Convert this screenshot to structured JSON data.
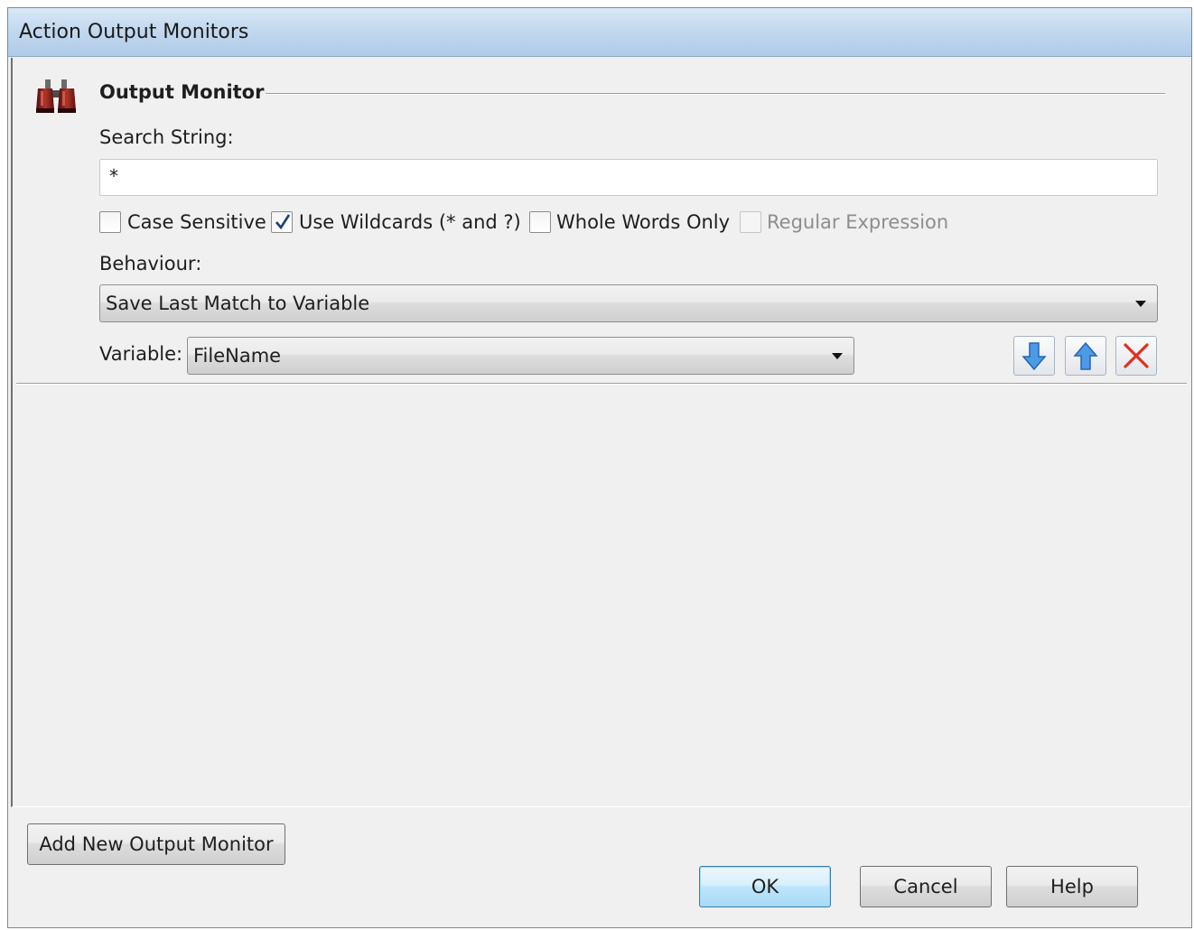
{
  "window": {
    "title": "Action Output Monitors"
  },
  "monitor": {
    "group_title": "Output Monitor",
    "search_label": "Search String:",
    "search_value": "*",
    "options": [
      {
        "label": "Case Sensitive",
        "checked": false,
        "enabled": true
      },
      {
        "label": "Use Wildcards (* and ?)",
        "checked": true,
        "enabled": true
      },
      {
        "label": "Whole Words Only",
        "checked": false,
        "enabled": true
      },
      {
        "label": "Regular Expression",
        "checked": false,
        "enabled": false
      }
    ],
    "behaviour_label": "Behaviour:",
    "behaviour_value": "Save Last Match to Variable",
    "variable_label": "Variable:",
    "variable_value": "FileName",
    "icons": {
      "monitor": "binoculars-icon",
      "move_down": "arrow-down-icon",
      "move_up": "arrow-up-icon",
      "delete": "delete-x-icon"
    }
  },
  "footer": {
    "add_button": "Add New Output Monitor",
    "ok_button": "OK",
    "cancel_button": "Cancel",
    "help_button": "Help"
  },
  "colors": {
    "title_bar": "#c1d7ee",
    "arrow_blue": "#3f8fdc",
    "delete_red": "#e0301e",
    "default_button": "#bee6fd"
  }
}
